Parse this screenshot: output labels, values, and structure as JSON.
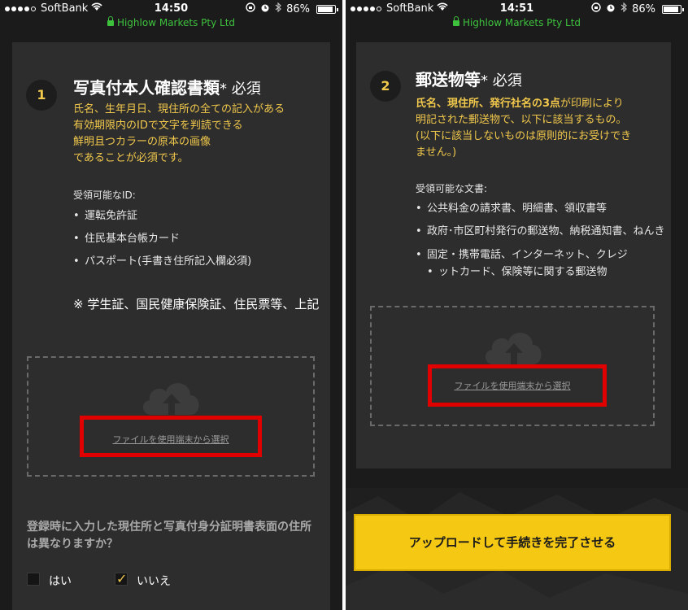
{
  "left": {
    "status": {
      "carrier": "SoftBank",
      "time": "14:50",
      "battery": "86%",
      "battery_level": 0.86
    },
    "url": "Highlow Markets Pty Ltd",
    "step": {
      "number": "1",
      "title": "写真付本人確認書類",
      "required": "* 必須",
      "requirements": [
        "氏名、生年月日、現住所の全ての記入がある",
        "有効期限内のIDで文字を判読できる",
        "鮮明且つカラーの原本の画像",
        "であることが必須です。"
      ],
      "accepted_label": "受領可能なID:",
      "accepted_items": [
        "運転免許証",
        "住民基本台帳カード",
        "パスポート(手書き住所記入欄必須)"
      ],
      "note": "※ 学生証、国民健康保険証、住民票等、上記",
      "file_link": "ファイルを使用端末から選択"
    },
    "question": "登録時に入力した現住所と写真付身分証明書表面の住所は異なりますか？",
    "options": [
      {
        "label": "はい",
        "checked": false
      },
      {
        "label": "いいえ",
        "checked": true
      }
    ]
  },
  "right": {
    "status": {
      "carrier": "SoftBank",
      "time": "14:51",
      "battery": "86%",
      "battery_level": 0.86
    },
    "url": "Highlow Markets Pty Ltd",
    "step": {
      "number": "2",
      "title": "郵送物等",
      "required": "* 必須",
      "req_bold": "氏名、現住所、発行社名の3点",
      "req_line1_rest": "が印刷により",
      "requirements_rest": [
        "明記された郵送物で、以下に該当するもの。",
        "(以下に該当しないものは原則的にお受けでき",
        "ません。)"
      ],
      "accepted_label": "受領可能な文書:",
      "accepted_items": [
        "公共料金の請求書、明細書、領収書等",
        "政府･市区町村発行の郵送物、納税通知書、ねんき",
        "固定・携帯電話、インターネット、クレジ"
      ],
      "accepted_item3_cont": "ットカード、保険等に関する郵送物",
      "file_link": "ファイルを使用端末から選択"
    },
    "upload_button": "アップロードして手続きを完了させる"
  }
}
